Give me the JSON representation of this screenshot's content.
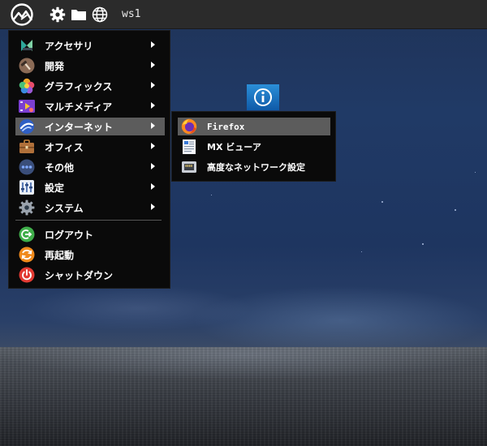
{
  "panel": {
    "workspace_label": "ws1",
    "icons": [
      "mx-logo-icon",
      "gear-icon",
      "folder-icon",
      "globe-icon"
    ]
  },
  "desktop": {
    "icon": "info-icon"
  },
  "menu": {
    "items": [
      {
        "label": "アクセサリ",
        "icon": "accessories-icon",
        "submenu": true
      },
      {
        "label": "開発",
        "icon": "hammer-icon",
        "submenu": true
      },
      {
        "label": "グラフィックス",
        "icon": "graphics-icon",
        "submenu": true
      },
      {
        "label": "マルチメディア",
        "icon": "multimedia-icon",
        "submenu": true
      },
      {
        "label": "インターネット",
        "icon": "internet-icon",
        "submenu": true,
        "active": true
      },
      {
        "label": "オフィス",
        "icon": "briefcase-icon",
        "submenu": true
      },
      {
        "label": "その他",
        "icon": "more-icon",
        "submenu": true
      },
      {
        "label": "設定",
        "icon": "settings-icon",
        "submenu": true
      },
      {
        "label": "システム",
        "icon": "system-gear-icon",
        "submenu": true
      }
    ],
    "actions": [
      {
        "label": "ログアウト",
        "icon": "logout-icon"
      },
      {
        "label": "再起動",
        "icon": "restart-icon"
      },
      {
        "label": "シャットダウン",
        "icon": "power-icon"
      }
    ]
  },
  "submenu": {
    "items": [
      {
        "label": "Firefox",
        "icon": "firefox-icon",
        "active": true
      },
      {
        "label": "MX ビューア",
        "icon": "document-viewer-icon"
      },
      {
        "label": "高度なネットワーク設定",
        "icon": "network-icon"
      }
    ]
  },
  "colors": {
    "panel_bg": "#2b2b2b",
    "menu_bg": "#0a0a0a",
    "highlight": "#5c5c5c"
  }
}
